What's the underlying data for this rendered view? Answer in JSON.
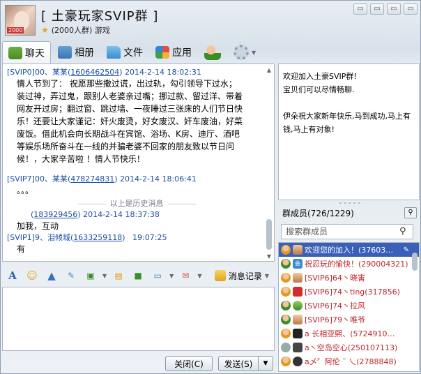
{
  "header": {
    "title": "[  土豪玩家SVIP群  ]",
    "subtitle": "(2000人群) 游戏",
    "avatar_tag": "2000"
  },
  "window_buttons": [
    "▭",
    "▭",
    "▭",
    "▭"
  ],
  "tabs": [
    {
      "label": "聊天",
      "icon": "chat-icon",
      "active": true
    },
    {
      "label": "相册",
      "icon": "album-icon"
    },
    {
      "label": "文件",
      "icon": "folder-icon"
    },
    {
      "label": "应用",
      "icon": "apps-icon"
    }
  ],
  "messages": [
    {
      "sender": "[SVIP0]00、某某",
      "qq": "1606462504",
      "time": "2014-2-14 18:02:31",
      "lines": [
        "情人节到了： 祝愿那些撒过谎，出过轨，勾引领导下过水；",
        "装过神，弄过鬼，跟别人老婆亲过嘴；挪过款、留过洋、带着",
        "网友开过房；翻过窗、跳过墙、一夜睡过三张床的人们节日快",
        "乐！还要让大家谨记：奸火废烫，好女废汉、奸车废油，好菜",
        "废饭。借此机会向长期战斗在宾馆、浴场、K房、迪厅、酒吧",
        "等娱乐场所奋斗在一线的并骗老婆不回家的朋友致以节日问",
        "候！，大家辛苦啦 ！情人节快乐！"
      ]
    },
    {
      "sender": "[SVIP7]00、某某",
      "qq": "478274831",
      "time": "2014-2-14 18:06:41",
      "lines": [
        "。。。"
      ]
    },
    {
      "divider": "以上是历史消息"
    },
    {
      "sender": "",
      "qq": "183929456",
      "time": "2014-2-14 18:37:38",
      "lines": [
        "加我，互动"
      ]
    },
    {
      "sender": "[SVIP1]9、泪倾城",
      "qq": "1633259118",
      "time": "19:07:25",
      "lines": [
        "有"
      ]
    }
  ],
  "toolbar": {
    "font": "A",
    "emoji": "☺",
    "record_label": "消息记录"
  },
  "buttons": {
    "close": "关闭(C)",
    "send": "发送(S)"
  },
  "notice": {
    "lines": [
      "欢迎加入土豪SVIP群!",
      "宝贝们可以尽情畅聊.",
      "伊朵祝大家新年快乐,马到成功,马上有钱,马上有对象!"
    ]
  },
  "members": {
    "header": "群成员(726/1229)",
    "search_placeholder": "搜索群成员",
    "items": [
      {
        "text": "欢迎您的加入！(37603…",
        "selected": true,
        "role": "owner"
      },
      {
        "text": "祝忍玩的愉快！(290004321)",
        "role": "admin"
      },
      {
        "text": "[SVIP6]64丶晓害",
        "role": "admin"
      },
      {
        "text": "[SVIP6]74丶ting(317856)",
        "role": "admin"
      },
      {
        "text": "[SVIP6]74丶拉风",
        "role": "admin"
      },
      {
        "text": "[SVIP6]79丶唯爷",
        "role": "admin"
      },
      {
        "text": "a      长相亚熙、(5724910…",
        "role": "member"
      },
      {
        "text": "a丶空岛空心(250107113)",
        "role": "member"
      },
      {
        "text": "a乄〞阿伦 ˘ 乀(2788848)",
        "role": "member"
      }
    ]
  }
}
